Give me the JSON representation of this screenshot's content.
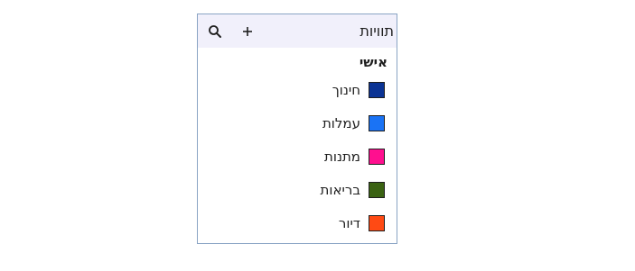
{
  "labels_panel": {
    "title": "תוויות",
    "add_icon": "plus-icon",
    "search_icon": "search-icon",
    "section_heading": "אישי",
    "items": [
      {
        "label": "חינוך",
        "color": "#0b3394"
      },
      {
        "label": "עמלות",
        "color": "#1a73f5"
      },
      {
        "label": "מתנות",
        "color": "#ff0f8f"
      },
      {
        "label": "בריאות",
        "color": "#3a6212"
      },
      {
        "label": "דיור",
        "color": "#ff4a14"
      }
    ]
  }
}
